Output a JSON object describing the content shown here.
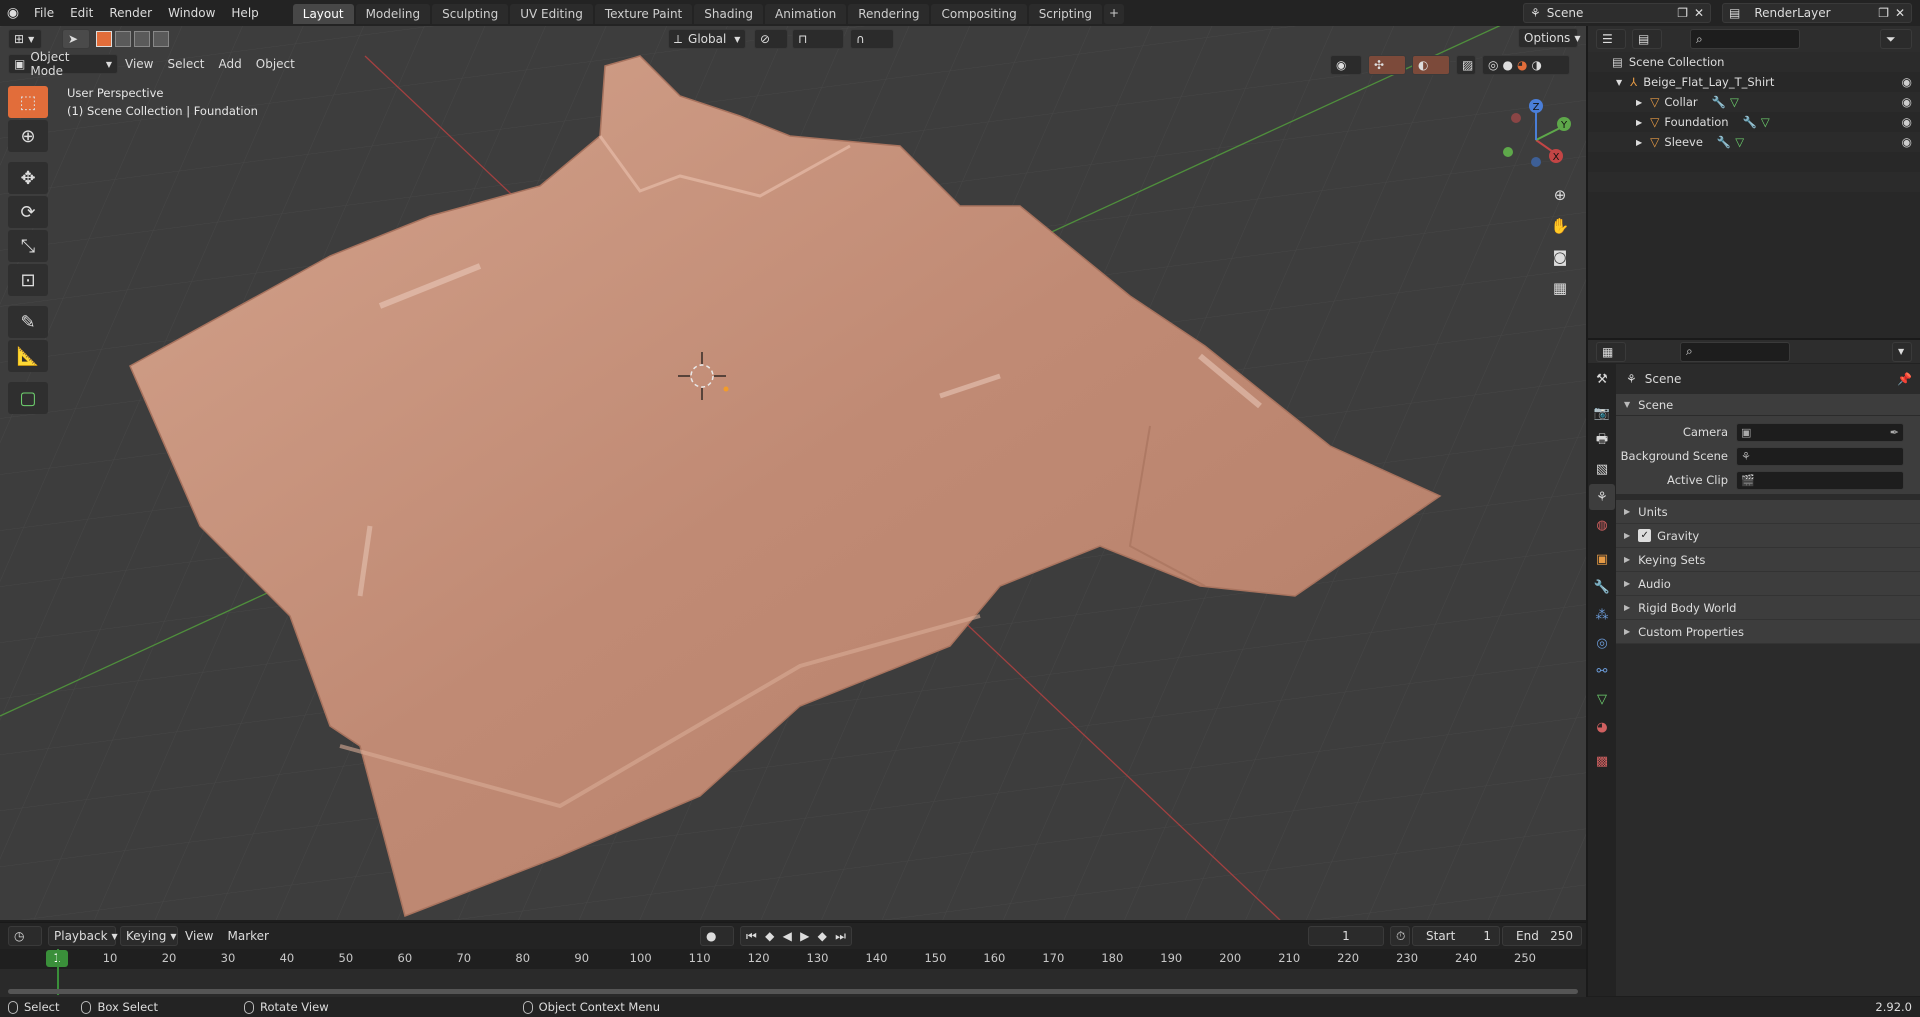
{
  "topbar": {
    "menus": [
      "File",
      "Edit",
      "Render",
      "Window",
      "Help"
    ],
    "workspaces": [
      "Layout",
      "Modeling",
      "Sculpting",
      "UV Editing",
      "Texture Paint",
      "Shading",
      "Animation",
      "Rendering",
      "Compositing",
      "Scripting"
    ],
    "active_workspace": "Layout",
    "add_label": "+",
    "scene_name": "Scene",
    "view_layer": "RenderLayer"
  },
  "viewport": {
    "mode": "Object Mode",
    "menus": [
      "View",
      "Select",
      "Add",
      "Object"
    ],
    "orientation": "Global",
    "options_label": "Options",
    "perspective_label": "User Perspective",
    "collection_label": "(1) Scene Collection | Foundation",
    "gizmo": {
      "x": "X",
      "y": "Y",
      "z": "Z"
    }
  },
  "timeline": {
    "menus": [
      "Playback",
      "Keying",
      "View",
      "Marker"
    ],
    "current_frame": "1",
    "start_label": "Start",
    "start_value": "1",
    "end_label": "End",
    "end_value": "250",
    "ruler": [
      "1",
      "10",
      "20",
      "30",
      "40",
      "50",
      "60",
      "70",
      "80",
      "90",
      "100",
      "110",
      "120",
      "130",
      "140",
      "150",
      "160",
      "170",
      "180",
      "190",
      "200",
      "210",
      "220",
      "230",
      "240",
      "250"
    ]
  },
  "outliner": {
    "root": "Scene Collection",
    "collection": "Beige_Flat_Lay_T_Shirt",
    "objects": [
      "Collar",
      "Foundation",
      "Sleeve"
    ]
  },
  "properties": {
    "header_title": "Scene",
    "panel_title": "Scene",
    "camera_label": "Camera",
    "background_scene_label": "Background Scene",
    "active_clip_label": "Active Clip",
    "subpanels": [
      "Units",
      "Gravity",
      "Keying Sets",
      "Audio",
      "Rigid Body World",
      "Custom Properties"
    ]
  },
  "status": {
    "select": "Select",
    "box_select": "Box Select",
    "rotate_view": "Rotate View",
    "context_menu": "Object Context Menu",
    "version": "2.92.0"
  },
  "colors": {
    "viewport_bg": "#3d3d3d",
    "x_axis": "#b84141",
    "y_axis": "#4e9a3e",
    "shirt": "#c4907a",
    "active_tab": "#474747"
  }
}
